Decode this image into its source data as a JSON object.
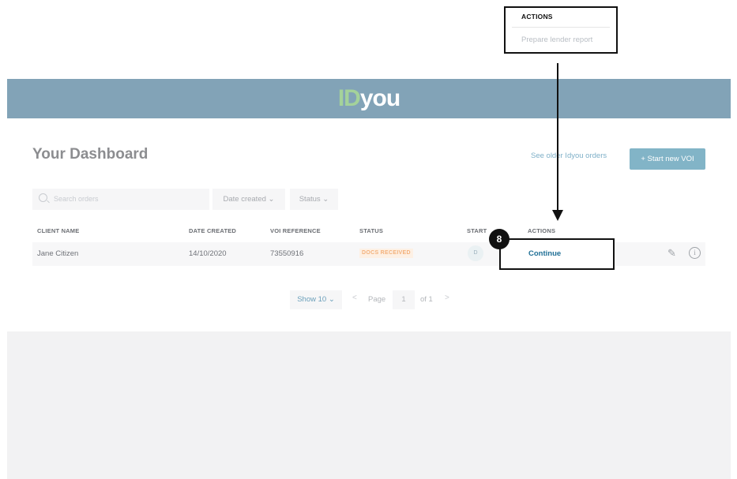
{
  "callout": {
    "header": "ACTIONS",
    "item": "Prepare lender report"
  },
  "header": {
    "logo_id": "ID",
    "logo_you": "you"
  },
  "dashboard": {
    "title": "Your Dashboard",
    "older_link": "See older Idyou orders",
    "start_button": "+ Start new VOI"
  },
  "filters": {
    "search_placeholder": "Search orders",
    "date_created": "Date created ⌄",
    "status": "Status ⌄"
  },
  "table": {
    "columns": [
      "CLIENT NAME",
      "DATE CREATED",
      "VOI REFERENCE",
      "STATUS",
      "START",
      "ACTIONS"
    ],
    "rows": [
      {
        "client_name": "Jane Citizen",
        "date_created": "14/10/2020",
        "voi_reference": "73550916",
        "status": "DOCS RECEIVED",
        "started_by": "D",
        "action": "Continue"
      }
    ]
  },
  "annotation": {
    "step": "8"
  },
  "pagination": {
    "show": "Show 10 ⌄",
    "prev": "<",
    "page_label": "Page",
    "page": "1",
    "of": "of 1",
    "next": ">"
  },
  "icons": [
    "search-icon",
    "pencil-icon",
    "info-icon"
  ],
  "colors": {
    "header_bg": "#82a3b7",
    "logo_accent": "#a4d29a",
    "primary_button": "#82b4c7",
    "badge_text": "#f3b17b"
  }
}
